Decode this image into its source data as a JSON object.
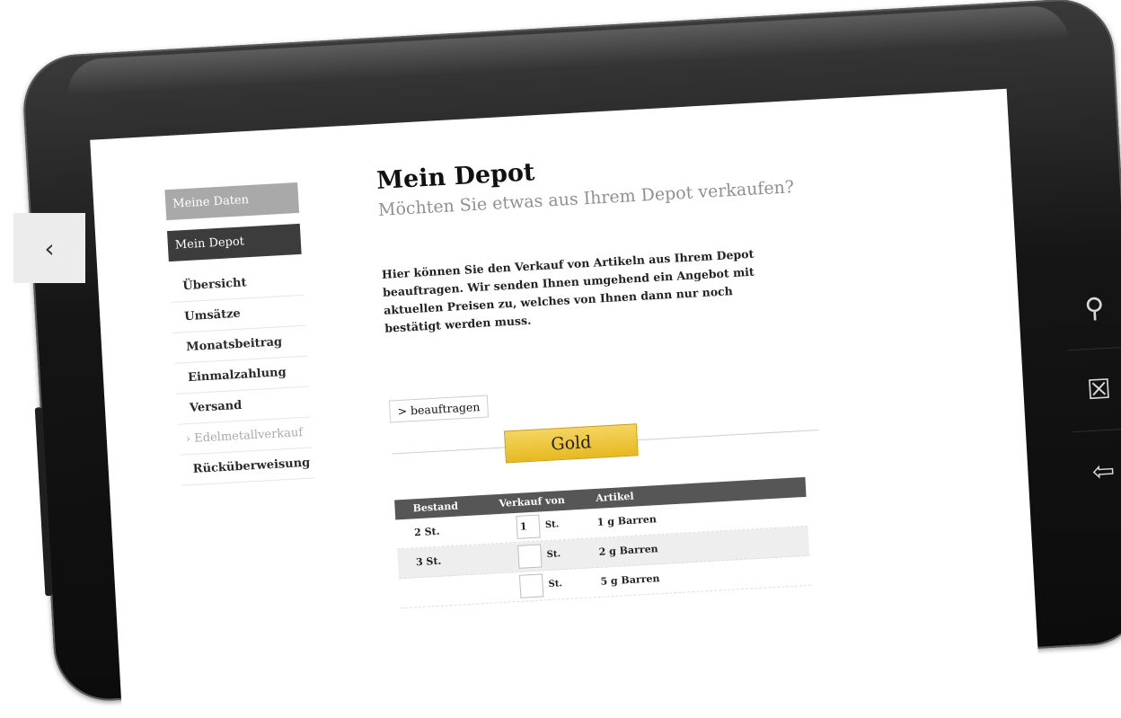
{
  "nav": {
    "back_icon": "chevron-left-icon"
  },
  "device": {
    "buttons": [
      {
        "icon": "search-icon",
        "glyph": "⚲"
      },
      {
        "icon": "menu-icon",
        "glyph": "☒"
      },
      {
        "icon": "back-icon",
        "glyph": "⇦"
      }
    ]
  },
  "sidebar": {
    "tabs": [
      {
        "label": "Meine Daten"
      },
      {
        "label": "Mein Depot"
      }
    ],
    "items": [
      {
        "label": "Übersicht"
      },
      {
        "label": "Umsätze"
      },
      {
        "label": "Monatsbeitrag"
      },
      {
        "label": "Einmalzahlung"
      },
      {
        "label": "Versand"
      },
      {
        "label": "› Edelmetallverkauf"
      },
      {
        "label": "Rücküberweisung"
      }
    ]
  },
  "main": {
    "title": "Mein Depot",
    "subtitle": "Möchten Sie etwas aus Ihrem Depot verkaufen?",
    "intro": "Hier können Sie den Verkauf von Artikeln aus Ihrem Depot beauftragen. Wir senden Ihnen umgehend ein Angebot mit aktuellen Preisen zu, welches von Ihnen dann nur noch bestätigt werden muss.",
    "order_button": "> beauftragen",
    "metal": "Gold"
  },
  "table": {
    "headers": [
      "Bestand",
      "Verkauf von",
      "Artikel"
    ],
    "rows": [
      {
        "stock": "2 St.",
        "qty": "1",
        "unit": "St.",
        "article": "1 g Barren"
      },
      {
        "stock": "3 St.",
        "qty": "",
        "unit": "St.",
        "article": "2 g Barren"
      },
      {
        "stock": "",
        "qty": "",
        "unit": "St.",
        "article": "5 g Barren"
      }
    ]
  }
}
